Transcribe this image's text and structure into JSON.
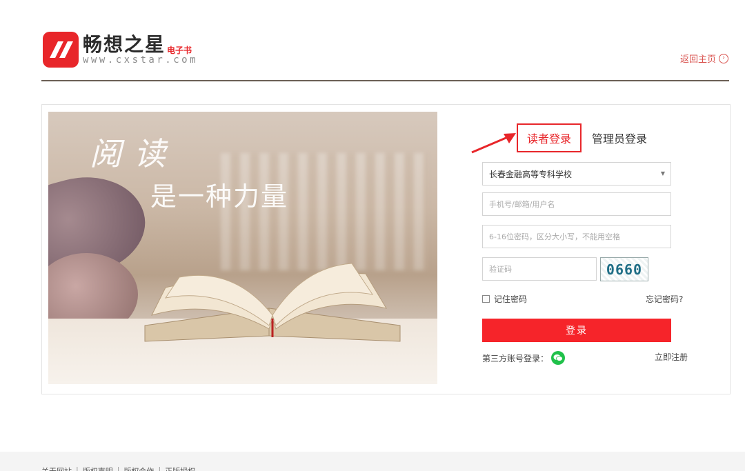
{
  "header": {
    "logo_cn": "畅想之星",
    "logo_badge": "电子书",
    "logo_url": "www.cxstar.com",
    "home_link": "返回主页",
    "home_icon": "arrow-right-circle-icon",
    "accent_color": "#e8262a"
  },
  "hero": {
    "title": "阅读",
    "subtitle": "是一种力量"
  },
  "tabs": {
    "reader": "读者登录",
    "admin": "管理员登录"
  },
  "form": {
    "institution_selected": "长春金融高等专科学校",
    "username_placeholder": "手机号/邮箱/用户名",
    "password_placeholder": "6-16位密码，区分大小写，不能用空格",
    "captcha_placeholder": "验证码",
    "captcha_value": "0660",
    "remember_label": "记住密码",
    "forgot_label": "忘记密码?",
    "login_label": "登录",
    "third_party_label": "第三方账号登录：",
    "register_label": "立即注册",
    "button_color": "#f6242a",
    "wechat_color": "#20c14a"
  },
  "footer": {
    "links": [
      "关于网站",
      "版权声明",
      "版权合作",
      "正版授权"
    ]
  }
}
